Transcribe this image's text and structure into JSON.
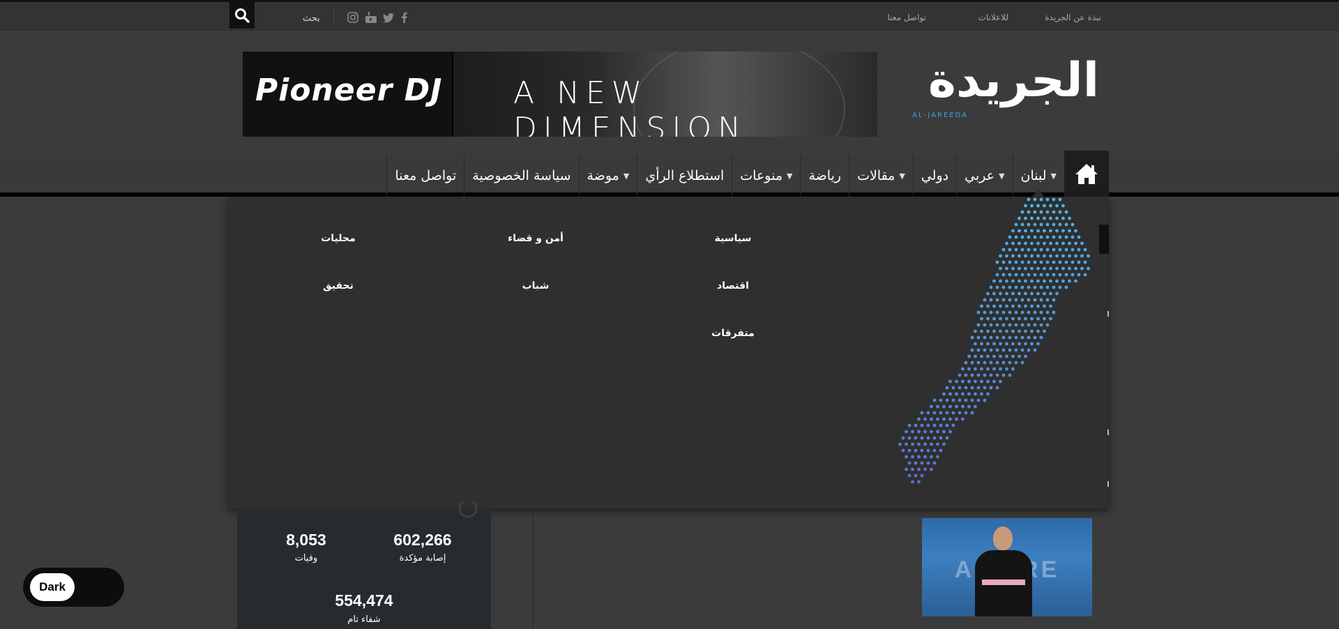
{
  "topbar": {
    "links": [
      "نبذة عن الجريدة",
      "للاعلانات",
      "تواصل معنا"
    ],
    "search_label": "بحث",
    "social_icons": [
      "facebook-icon",
      "twitter-icon",
      "youtube-icon",
      "instagram-icon"
    ]
  },
  "header": {
    "logo_text": "الجريدة",
    "logo_subtext": "AL-JAREEDA",
    "banner_brand": "Pioneer DJ",
    "banner_tagline": "A NEW DIMENSION"
  },
  "nav": {
    "items": [
      {
        "label": "لبنان",
        "dropdown": true
      },
      {
        "label": "عربي",
        "dropdown": true
      },
      {
        "label": "دولي",
        "dropdown": false
      },
      {
        "label": "مقالات",
        "dropdown": true
      },
      {
        "label": "رياضة",
        "dropdown": false
      },
      {
        "label": "منوعات",
        "dropdown": true
      },
      {
        "label": "استطلاع الرأي",
        "dropdown": false
      },
      {
        "label": "موضة",
        "dropdown": true
      },
      {
        "label": "سياسة الخصوصية",
        "dropdown": false
      },
      {
        "label": "تواصل معنا",
        "dropdown": false
      }
    ]
  },
  "dropdown": {
    "subitems": [
      "سياسية",
      "أمن و قضاء",
      "محليات",
      "اقتصاد",
      "شباب",
      "تحقيق",
      "متفرقات"
    ]
  },
  "covid": {
    "confirmed_value": "602,266",
    "confirmed_label": "إصابة مؤكدة",
    "deaths_value": "8,053",
    "deaths_label": "وفيات",
    "recovered_value": "554,474",
    "recovered_label": "شفاء تام"
  },
  "dark_toggle": {
    "label": "Dark"
  },
  "colors": {
    "accent": "#4a9fd8",
    "map_top": "#4db6e6",
    "map_bottom": "#5a6fd0"
  }
}
